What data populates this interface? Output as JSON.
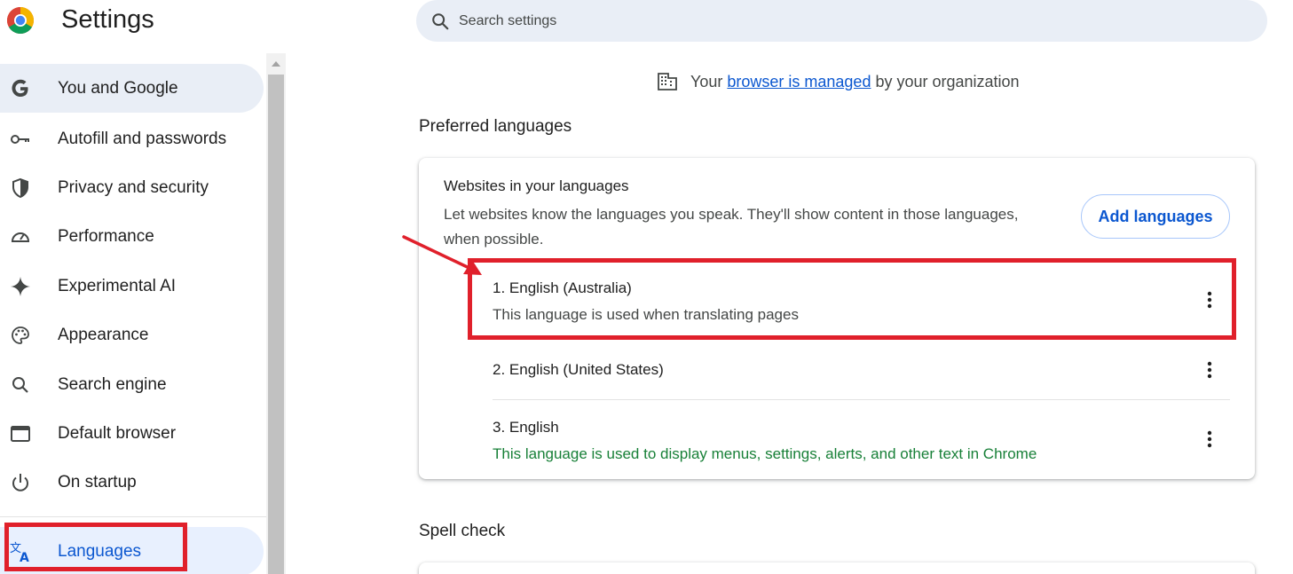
{
  "header": {
    "title": "Settings",
    "search_placeholder": "Search settings"
  },
  "sidebar": {
    "items": [
      {
        "label": "You and Google",
        "icon": "google-g-icon"
      },
      {
        "label": "Autofill and passwords",
        "icon": "key-icon"
      },
      {
        "label": "Privacy and security",
        "icon": "shield-icon"
      },
      {
        "label": "Performance",
        "icon": "speedometer-icon"
      },
      {
        "label": "Experimental AI",
        "icon": "sparkle-icon"
      },
      {
        "label": "Appearance",
        "icon": "palette-icon"
      },
      {
        "label": "Search engine",
        "icon": "search-icon"
      },
      {
        "label": "Default browser",
        "icon": "browser-window-icon"
      },
      {
        "label": "On startup",
        "icon": "power-icon"
      },
      {
        "label": "Languages",
        "icon": "translate-icon"
      }
    ]
  },
  "managed_notice": {
    "prefix": "Your",
    "link": "browser is managed",
    "suffix": "by your organization"
  },
  "preferred_languages": {
    "section_title": "Preferred languages",
    "card_title": "Websites in your languages",
    "card_description": "Let websites know the languages you speak. They'll show content in those languages, when possible.",
    "add_button": "Add languages",
    "languages": [
      {
        "name": "1. English (Australia)",
        "note": "This language is used when translating pages"
      },
      {
        "name": "2. English (United States)",
        "note": ""
      },
      {
        "name": "3. English",
        "note": "This language is used to display menus, settings, alerts, and other text in Chrome"
      }
    ]
  },
  "spell_check": {
    "section_title": "Spell check"
  },
  "colors": {
    "accent": "#0b57d0",
    "annotation": "#e0202b",
    "green_note": "#188038",
    "nav_active_bg": "#e9eef6",
    "nav_selected_bg": "#e8f0fe"
  }
}
